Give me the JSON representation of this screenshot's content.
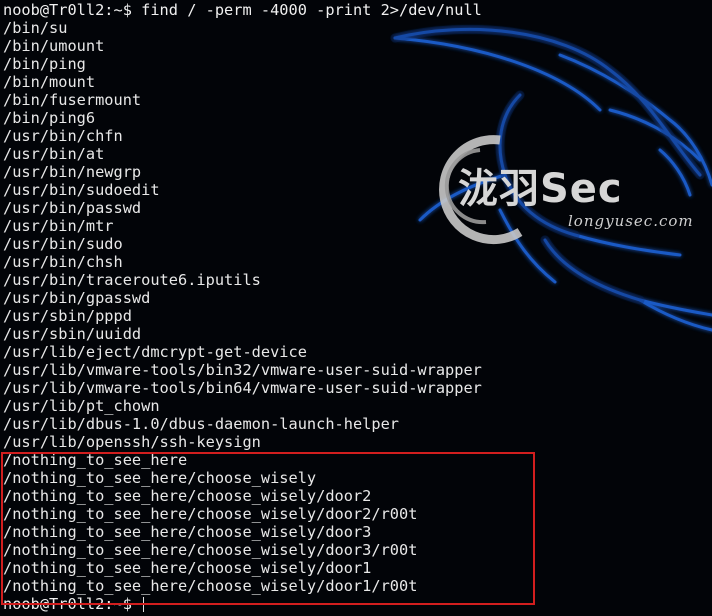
{
  "terminal": {
    "command_line": "noob@Tr0ll2:~$ find / -perm -4000 -print 2>/dev/null",
    "output": [
      "/bin/su",
      "/bin/umount",
      "/bin/ping",
      "/bin/mount",
      "/bin/fusermount",
      "/bin/ping6",
      "/usr/bin/chfn",
      "/usr/bin/at",
      "/usr/bin/newgrp",
      "/usr/bin/sudoedit",
      "/usr/bin/passwd",
      "/usr/bin/mtr",
      "/usr/bin/sudo",
      "/usr/bin/chsh",
      "/usr/bin/traceroute6.iputils",
      "/usr/bin/gpasswd",
      "/usr/sbin/pppd",
      "/usr/sbin/uuidd",
      "/usr/lib/eject/dmcrypt-get-device",
      "/usr/lib/vmware-tools/bin32/vmware-user-suid-wrapper",
      "/usr/lib/vmware-tools/bin64/vmware-user-suid-wrapper",
      "/usr/lib/pt_chown",
      "/usr/lib/dbus-1.0/dbus-daemon-launch-helper",
      "/usr/lib/openssh/ssh-keysign",
      "/nothing_to_see_here",
      "/nothing_to_see_here/choose_wisely",
      "/nothing_to_see_here/choose_wisely/door2",
      "/nothing_to_see_here/choose_wisely/door2/r00t",
      "/nothing_to_see_here/choose_wisely/door3",
      "/nothing_to_see_here/choose_wisely/door3/r00t",
      "/nothing_to_see_here/choose_wisely/door1",
      "/nothing_to_see_here/choose_wisely/door1/r00t"
    ],
    "final_prompt": "noob@Tr0ll2:~$ "
  },
  "watermark": {
    "name": "泷羽Sec",
    "url": "longyusec.com"
  },
  "colors": {
    "background": "#020408",
    "text": "#e8e8e8",
    "highlight": "#d21e1e",
    "dragon": "#1f5fd0"
  }
}
